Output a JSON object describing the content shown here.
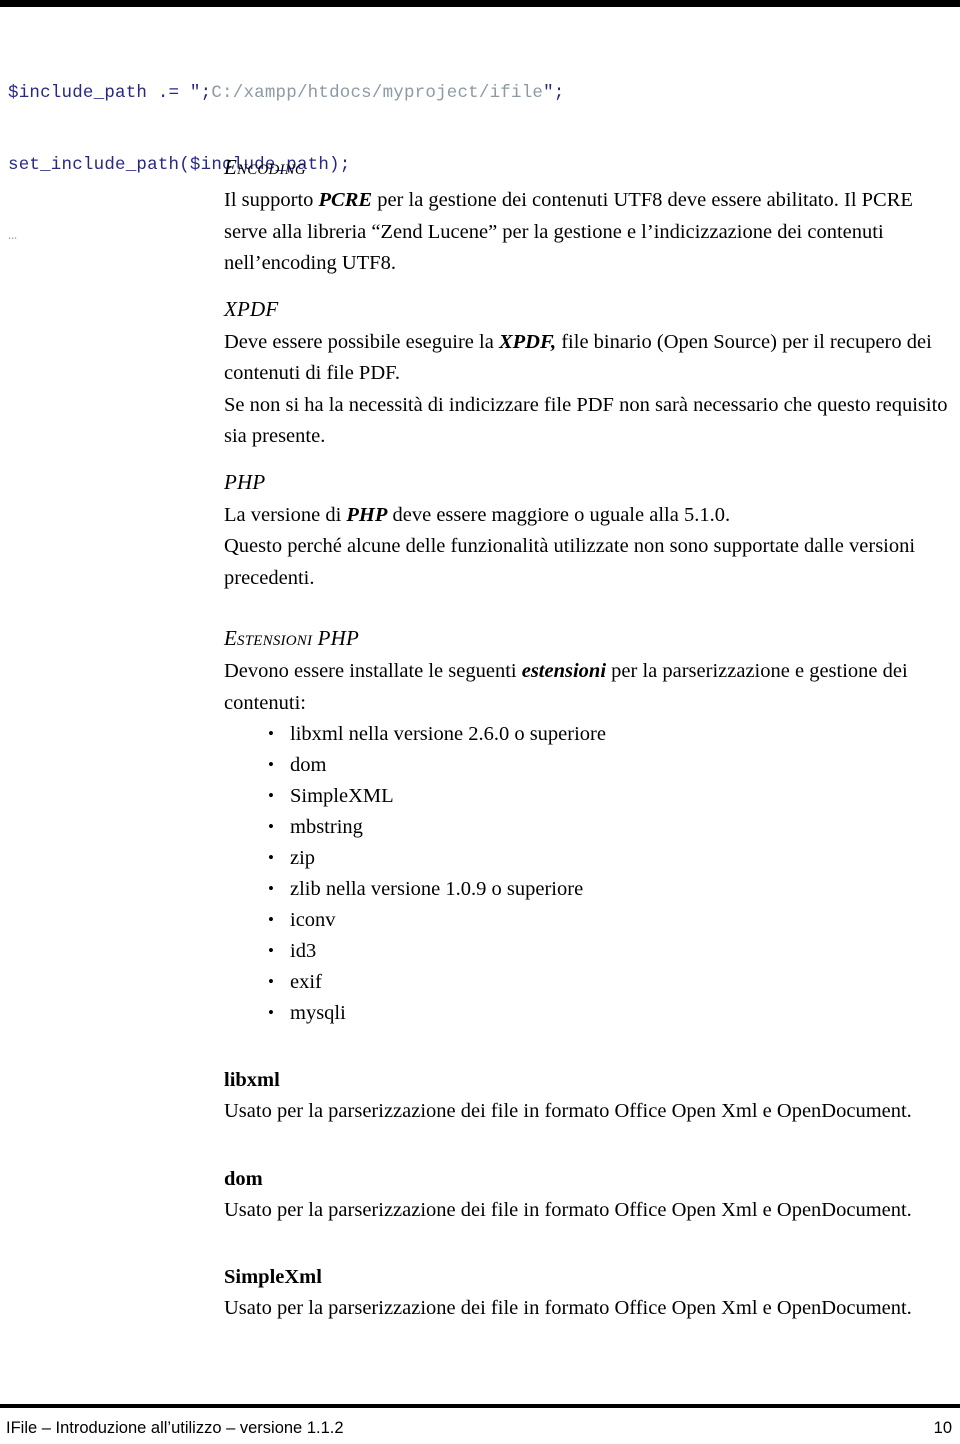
{
  "document": {
    "code_block": {
      "line1_var_a": "$include_path .= \";",
      "line1_str": "C:/xampp/htdocs/myproject/ifile",
      "line1_var_b": "\";",
      "line2": "set_include_path($include_path);",
      "ellipsis": "…",
      "color_keyword": "#282884",
      "color_string": "#8c9aa6"
    },
    "sections": [
      {
        "heading": "Encoding",
        "paragraph_parts": [
          {
            "text": "Il supporto ",
            "style": "normal"
          },
          {
            "text": "PCRE",
            "style": "bold-italic"
          },
          {
            "text": "  per la gestione dei contenuti UTF8 deve essere abilitato. Il PCRE serve alla libreria “Zend Lucene” per la gestione e l’indicizzazione dei contenuti nell’encoding UTF8.",
            "style": "normal"
          }
        ]
      },
      {
        "heading": "XPDF",
        "paragraph_parts": [
          {
            "text": "Deve essere possibile eseguire la ",
            "style": "normal"
          },
          {
            "text": "XPDF,",
            "style": "bold-italic"
          },
          {
            "text": "  file binario (Open Source) per il recupero dei contenuti di file PDF.",
            "style": "normal"
          }
        ],
        "paragraph2": " Se non si ha la necessità di indicizzare file PDF non sarà necessario che questo requisito sia presente."
      },
      {
        "heading": "PHP",
        "paragraph_parts": [
          {
            "text": "La versione di ",
            "style": "normal"
          },
          {
            "text": "PHP",
            "style": "bold-italic"
          },
          {
            "text": " deve essere maggiore o uguale alla 5.1.0.",
            "style": "normal"
          }
        ],
        "paragraph2": "Questo perché alcune delle funzionalità utilizzate non sono supportate dalle versioni precedenti."
      },
      {
        "heading": "Estensioni PHP",
        "paragraph_parts": [
          {
            "text": "Devono essere installate le seguenti ",
            "style": "normal"
          },
          {
            "text": "estensioni",
            "style": "bold-italic"
          },
          {
            "text": " per la parserizzazione e gestione dei contenuti:",
            "style": "normal"
          }
        ]
      }
    ],
    "extensions_list": [
      "libxml nella versione 2.6.0 o superiore",
      "dom",
      "SimpleXML",
      "mbstring",
      "zip",
      "zlib nella versione 1.0.9 o superiore",
      "iconv",
      "id3",
      "exif",
      "mysqli"
    ],
    "term_blocks": [
      {
        "term": "libxml",
        "description": "Usato  per la parserizzazione dei file in formato Office Open Xml e OpenDocument."
      },
      {
        "term": "dom",
        "description": "Usato  per la parserizzazione dei file in formato Office Open Xml e OpenDocument."
      },
      {
        "term": "SimpleXml",
        "description": "Usato  per la parserizzazione dei file in formato Office Open Xml e OpenDocument."
      }
    ],
    "footer": {
      "left": "IFile – Introduzione all’utilizzo – versione 1.1.2",
      "page_number": "10"
    }
  }
}
